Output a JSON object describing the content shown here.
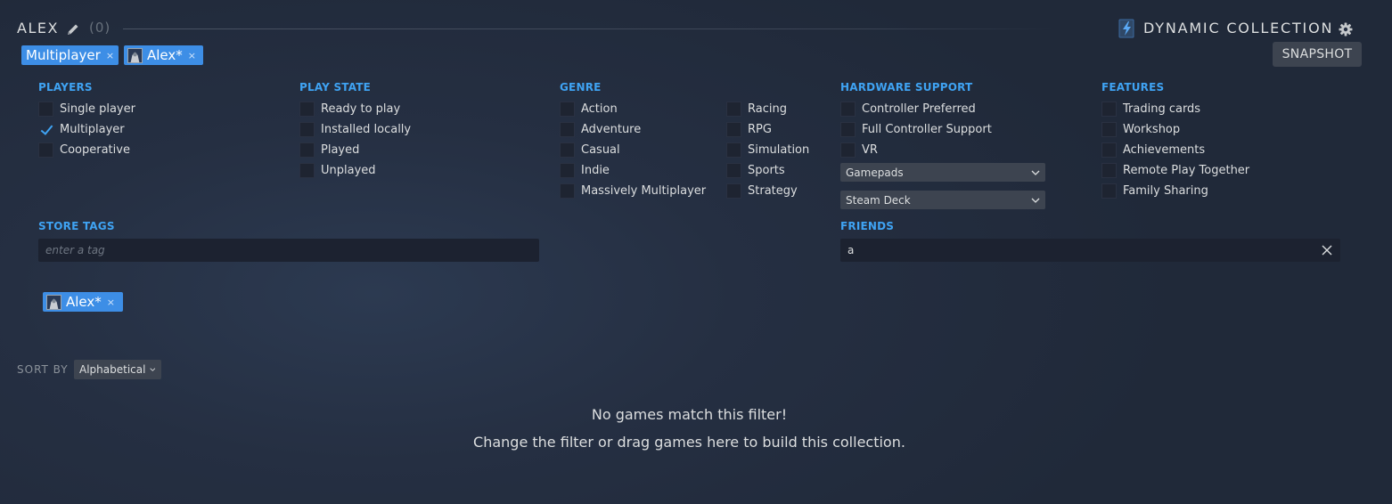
{
  "header": {
    "collection_name": "ALEX",
    "count": "(0)",
    "dynamic_label": "DYNAMIC COLLECTION",
    "snapshot_label": "SNAPSHOT"
  },
  "active_filters": [
    {
      "label": "Multiplayer",
      "remove": "×"
    },
    {
      "label": "Alex*",
      "remove": "×"
    }
  ],
  "players": {
    "title": "PLAYERS",
    "items": [
      {
        "label": "Single player",
        "checked": false
      },
      {
        "label": "Multiplayer",
        "checked": true
      },
      {
        "label": "Cooperative",
        "checked": false
      }
    ]
  },
  "play_state": {
    "title": "PLAY STATE",
    "items": [
      {
        "label": "Ready to play",
        "checked": false
      },
      {
        "label": "Installed locally",
        "checked": false
      },
      {
        "label": "Played",
        "checked": false
      },
      {
        "label": "Unplayed",
        "checked": false
      }
    ]
  },
  "genre": {
    "title": "GENRE",
    "col1": [
      {
        "label": "Action",
        "checked": false
      },
      {
        "label": "Adventure",
        "checked": false
      },
      {
        "label": "Casual",
        "checked": false
      },
      {
        "label": "Indie",
        "checked": false
      },
      {
        "label": "Massively Multiplayer",
        "checked": false
      }
    ],
    "col2": [
      {
        "label": "Racing",
        "checked": false
      },
      {
        "label": "RPG",
        "checked": false
      },
      {
        "label": "Simulation",
        "checked": false
      },
      {
        "label": "Sports",
        "checked": false
      },
      {
        "label": "Strategy",
        "checked": false
      }
    ]
  },
  "hardware": {
    "title": "HARDWARE SUPPORT",
    "items": [
      {
        "label": "Controller Preferred",
        "checked": false
      },
      {
        "label": "Full Controller Support",
        "checked": false
      },
      {
        "label": "VR",
        "checked": false
      }
    ],
    "dropdown1": "Gamepads",
    "dropdown2": "Steam Deck"
  },
  "features": {
    "title": "FEATURES",
    "items": [
      {
        "label": "Trading cards",
        "checked": false
      },
      {
        "label": "Workshop",
        "checked": false
      },
      {
        "label": "Achievements",
        "checked": false
      },
      {
        "label": "Remote Play Together",
        "checked": false
      },
      {
        "label": "Family Sharing",
        "checked": false
      }
    ]
  },
  "store_tags": {
    "title": "STORE TAGS",
    "placeholder": "enter a tag"
  },
  "friends": {
    "title": "FRIENDS",
    "value": "a",
    "selected_chip": {
      "label": "Alex*",
      "remove": "×"
    }
  },
  "sort": {
    "label": "SORT BY",
    "value": "Alphabetical"
  },
  "empty": {
    "line1": "No games match this filter!",
    "line2": "Change the filter or drag games here to build this collection."
  },
  "colors": {
    "accent": "#3fa3f3",
    "chip": "#3d8ee6",
    "background": "#242e40"
  }
}
